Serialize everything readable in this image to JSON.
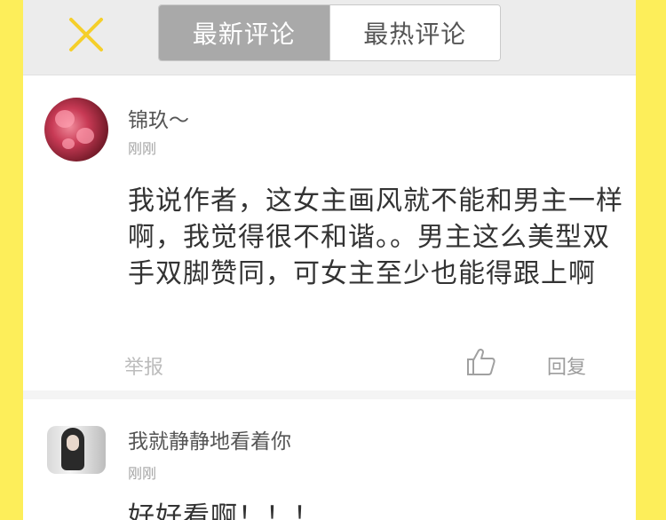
{
  "header": {
    "close_icon": "close-icon",
    "tabs": [
      {
        "label": "最新评论",
        "active": true
      },
      {
        "label": "最热评论",
        "active": false
      }
    ],
    "accent_color": "#f5cf2a"
  },
  "comments": [
    {
      "username": "锦玖～",
      "time": "刚刚",
      "content": "我说作者，这女主画风就不能和男主一样啊，我觉得很不和谐。。男主这么美型双手双脚赞同，可女主至少也能得跟上啊",
      "report_label": "举报",
      "reply_label": "回复"
    },
    {
      "username": "我就静静地看着你",
      "time": "刚刚",
      "content": "好好看啊！！！"
    }
  ]
}
